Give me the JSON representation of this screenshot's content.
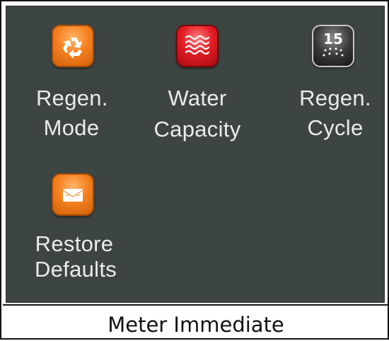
{
  "menu": {
    "items": [
      {
        "line1": "Regen.",
        "line2": "Mode",
        "icon": "recycle-icon",
        "color": "#f5811f"
      },
      {
        "line1": "Water",
        "line2": "Capacity",
        "icon": "water-waves-icon",
        "color": "#e41d25"
      },
      {
        "line1": "Regen.",
        "line2": "Cycle",
        "icon": "cycle-15-icon",
        "icon_text": "15",
        "color": "#3a3a3a"
      },
      {
        "line1": "Restore",
        "line2": "Defaults",
        "icon": "envelope-icon",
        "color": "#f5811f"
      }
    ]
  },
  "status": {
    "text": "Meter Immediate"
  }
}
